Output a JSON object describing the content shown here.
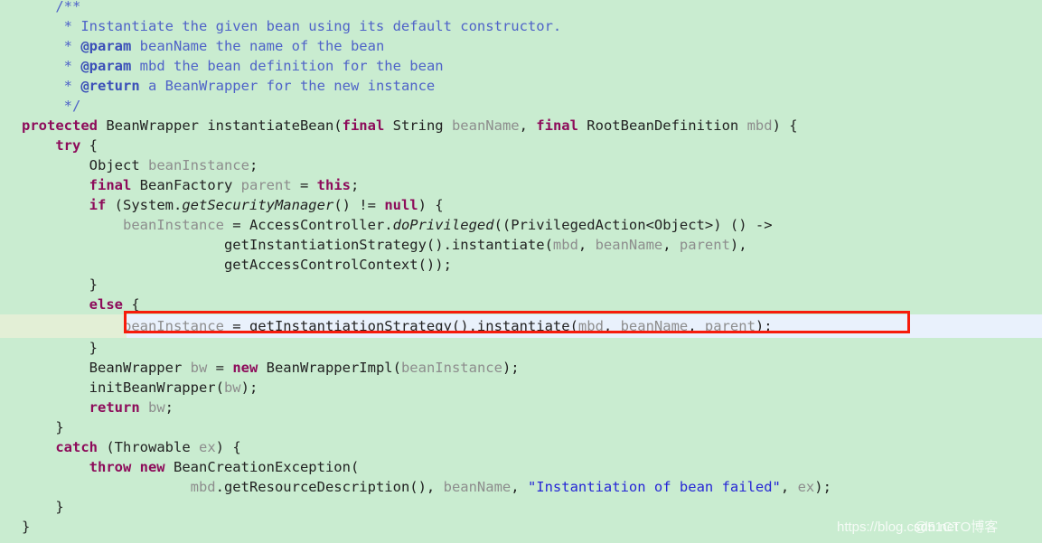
{
  "editor": {
    "background_color": "#c9ecd0",
    "highlight_row_color": "#e9f1fc",
    "highlight_gutter_color": "#e3efd6",
    "annotation_box_color": "#f71b0b",
    "comment_color": "#4f63c8",
    "keyword_color": "#8d0b5a",
    "string_color": "#2626d6",
    "variable_color": "#8d8d8d",
    "identifier_color": "#222222"
  },
  "code": {
    "language": "Java",
    "lines": [
      {
        "id": "line-1",
        "indent": 1,
        "highlight": false,
        "tokens": [
          {
            "t": "cmt",
            "s": "/**"
          }
        ]
      },
      {
        "id": "line-2",
        "indent": 1,
        "highlight": false,
        "tokens": [
          {
            "t": "cmt",
            "s": " * Instantiate the given bean using its default constructor."
          }
        ]
      },
      {
        "id": "line-3",
        "indent": 1,
        "highlight": false,
        "tokens": [
          {
            "t": "cmt",
            "s": " * "
          },
          {
            "t": "cmtb",
            "s": "@param"
          },
          {
            "t": "cmt",
            "s": " beanName the name of the bean"
          }
        ]
      },
      {
        "id": "line-4",
        "indent": 1,
        "highlight": false,
        "tokens": [
          {
            "t": "cmt",
            "s": " * "
          },
          {
            "t": "cmtb",
            "s": "@param"
          },
          {
            "t": "cmt",
            "s": " mbd the bean definition for the bean"
          }
        ]
      },
      {
        "id": "line-5",
        "indent": 1,
        "highlight": false,
        "tokens": [
          {
            "t": "cmt",
            "s": " * "
          },
          {
            "t": "cmtb",
            "s": "@return"
          },
          {
            "t": "cmt",
            "s": " a BeanWrapper for the new instance"
          }
        ]
      },
      {
        "id": "line-6",
        "indent": 1,
        "highlight": false,
        "tokens": [
          {
            "t": "cmt",
            "s": " */"
          }
        ]
      },
      {
        "id": "line-7",
        "indent": 0,
        "highlight": false,
        "tokens": [
          {
            "t": "kw",
            "s": "protected"
          },
          {
            "t": "id",
            "s": " BeanWrapper instantiateBean("
          },
          {
            "t": "kw",
            "s": "final"
          },
          {
            "t": "id",
            "s": " String "
          },
          {
            "t": "var",
            "s": "beanName"
          },
          {
            "t": "id",
            "s": ", "
          },
          {
            "t": "kw",
            "s": "final"
          },
          {
            "t": "id",
            "s": " RootBeanDefinition "
          },
          {
            "t": "var",
            "s": "mbd"
          },
          {
            "t": "id",
            "s": ") {"
          }
        ]
      },
      {
        "id": "line-8",
        "indent": 1,
        "highlight": false,
        "tokens": [
          {
            "t": "kw",
            "s": "try"
          },
          {
            "t": "id",
            "s": " {"
          }
        ]
      },
      {
        "id": "line-9",
        "indent": 2,
        "highlight": false,
        "tokens": [
          {
            "t": "id",
            "s": "Object "
          },
          {
            "t": "var",
            "s": "beanInstance"
          },
          {
            "t": "id",
            "s": ";"
          }
        ]
      },
      {
        "id": "line-10",
        "indent": 2,
        "highlight": false,
        "tokens": [
          {
            "t": "kw",
            "s": "final"
          },
          {
            "t": "id",
            "s": " BeanFactory "
          },
          {
            "t": "var",
            "s": "parent"
          },
          {
            "t": "id",
            "s": " = "
          },
          {
            "t": "kw",
            "s": "this"
          },
          {
            "t": "id",
            "s": ";"
          }
        ]
      },
      {
        "id": "line-11",
        "indent": 2,
        "highlight": false,
        "tokens": [
          {
            "t": "kw",
            "s": "if"
          },
          {
            "t": "id",
            "s": " (System."
          },
          {
            "t": "mth",
            "s": "getSecurityManager"
          },
          {
            "t": "id",
            "s": "() != "
          },
          {
            "t": "kw",
            "s": "null"
          },
          {
            "t": "id",
            "s": ") {"
          }
        ]
      },
      {
        "id": "line-12",
        "indent": 3,
        "highlight": false,
        "tokens": [
          {
            "t": "var",
            "s": "beanInstance"
          },
          {
            "t": "id",
            "s": " = AccessController."
          },
          {
            "t": "mth",
            "s": "doPrivileged"
          },
          {
            "t": "id",
            "s": "((PrivilegedAction<Object>) () ->"
          }
        ]
      },
      {
        "id": "line-13",
        "indent": 6,
        "highlight": false,
        "tokens": [
          {
            "t": "id",
            "s": "getInstantiationStrategy().instantiate("
          },
          {
            "t": "var",
            "s": "mbd"
          },
          {
            "t": "id",
            "s": ", "
          },
          {
            "t": "var",
            "s": "beanName"
          },
          {
            "t": "id",
            "s": ", "
          },
          {
            "t": "var",
            "s": "parent"
          },
          {
            "t": "id",
            "s": "),"
          }
        ]
      },
      {
        "id": "line-14",
        "indent": 6,
        "highlight": false,
        "tokens": [
          {
            "t": "id",
            "s": "getAccessControlContext());"
          }
        ]
      },
      {
        "id": "line-15",
        "indent": 2,
        "highlight": false,
        "tokens": [
          {
            "t": "id",
            "s": "}"
          }
        ]
      },
      {
        "id": "line-16",
        "indent": 2,
        "highlight": false,
        "tokens": [
          {
            "t": "kw",
            "s": "else"
          },
          {
            "t": "id",
            "s": " {"
          }
        ]
      },
      {
        "id": "line-17",
        "indent": 3,
        "highlight": true,
        "tokens": [
          {
            "t": "var",
            "s": "beanInstance"
          },
          {
            "t": "id",
            "s": " = getInstantiationStrategy().instantiate("
          },
          {
            "t": "var",
            "s": "mbd"
          },
          {
            "t": "id",
            "s": ", "
          },
          {
            "t": "var",
            "s": "beanName"
          },
          {
            "t": "id",
            "s": ", "
          },
          {
            "t": "var",
            "s": "parent"
          },
          {
            "t": "id",
            "s": ");"
          }
        ]
      },
      {
        "id": "line-18",
        "indent": 2,
        "highlight": false,
        "tokens": [
          {
            "t": "id",
            "s": "}"
          }
        ]
      },
      {
        "id": "line-19",
        "indent": 2,
        "highlight": false,
        "tokens": [
          {
            "t": "id",
            "s": "BeanWrapper "
          },
          {
            "t": "var",
            "s": "bw"
          },
          {
            "t": "id",
            "s": " = "
          },
          {
            "t": "kw",
            "s": "new"
          },
          {
            "t": "id",
            "s": " BeanWrapperImpl("
          },
          {
            "t": "var",
            "s": "beanInstance"
          },
          {
            "t": "id",
            "s": ");"
          }
        ]
      },
      {
        "id": "line-20",
        "indent": 2,
        "highlight": false,
        "tokens": [
          {
            "t": "id",
            "s": "initBeanWrapper("
          },
          {
            "t": "var",
            "s": "bw"
          },
          {
            "t": "id",
            "s": ");"
          }
        ]
      },
      {
        "id": "line-21",
        "indent": 2,
        "highlight": false,
        "tokens": [
          {
            "t": "kw",
            "s": "return"
          },
          {
            "t": "id",
            "s": " "
          },
          {
            "t": "var",
            "s": "bw"
          },
          {
            "t": "id",
            "s": ";"
          }
        ]
      },
      {
        "id": "line-22",
        "indent": 1,
        "highlight": false,
        "tokens": [
          {
            "t": "id",
            "s": "}"
          }
        ]
      },
      {
        "id": "line-23",
        "indent": 1,
        "highlight": false,
        "tokens": [
          {
            "t": "kw",
            "s": "catch"
          },
          {
            "t": "id",
            "s": " (Throwable "
          },
          {
            "t": "var",
            "s": "ex"
          },
          {
            "t": "id",
            "s": ") {"
          }
        ]
      },
      {
        "id": "line-24",
        "indent": 2,
        "highlight": false,
        "tokens": [
          {
            "t": "kw",
            "s": "throw new"
          },
          {
            "t": "id",
            "s": " BeanCreationException("
          }
        ]
      },
      {
        "id": "line-25",
        "indent": 5,
        "highlight": false,
        "tokens": [
          {
            "t": "var",
            "s": "mbd"
          },
          {
            "t": "id",
            "s": ".getResourceDescription(), "
          },
          {
            "t": "var",
            "s": "beanName"
          },
          {
            "t": "id",
            "s": ", "
          },
          {
            "t": "str",
            "s": "\"Instantiation of bean failed\""
          },
          {
            "t": "id",
            "s": ", "
          },
          {
            "t": "var",
            "s": "ex"
          },
          {
            "t": "id",
            "s": ");"
          }
        ]
      },
      {
        "id": "line-26",
        "indent": 1,
        "highlight": false,
        "tokens": [
          {
            "t": "id",
            "s": "}"
          }
        ]
      },
      {
        "id": "line-27",
        "indent": 0,
        "highlight": false,
        "tokens": [
          {
            "t": "id",
            "s": "}"
          }
        ]
      }
    ]
  },
  "annotation": {
    "type": "red-rectangle-highlight",
    "target_line_id": "line-17",
    "color": "#f71b0b"
  },
  "watermark": {
    "url_text": "https://blog.csdn.net",
    "site_text": "@51CTO博客"
  }
}
